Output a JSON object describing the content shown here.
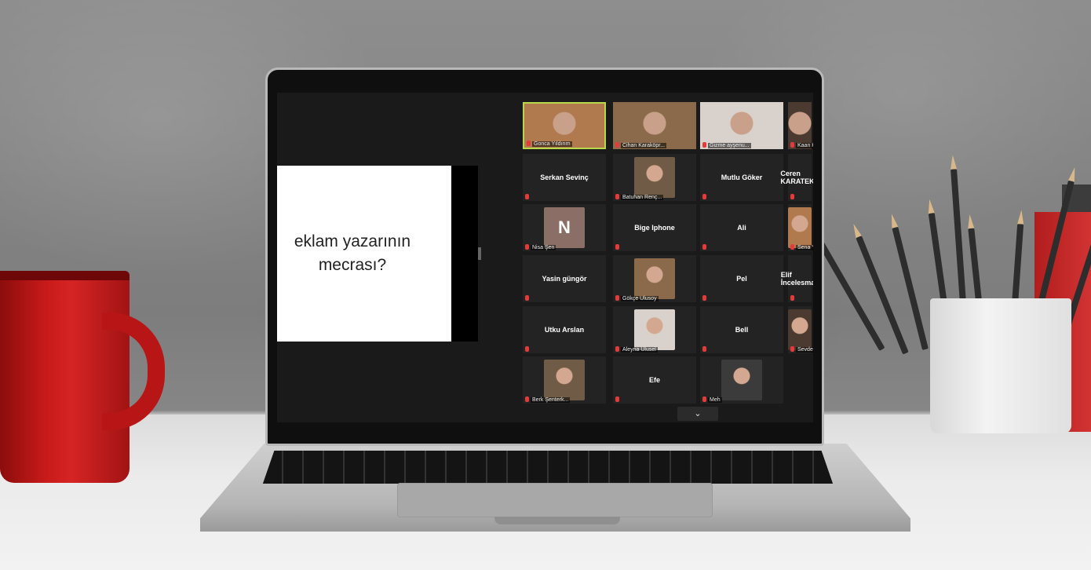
{
  "slide": {
    "line1": "eklam yazarının",
    "line2": "mecrası?"
  },
  "tiles": [
    {
      "name": "Gonca Yıldırım",
      "video": true,
      "active": true
    },
    {
      "name": "Cihan Karaköpr...",
      "video": true
    },
    {
      "name": "Gizme ayşenu...",
      "video": true
    },
    {
      "name": "Kaan K",
      "video": true
    },
    {
      "name": "Serkan Sevinç",
      "video": false
    },
    {
      "name": "Batuhan Renç...",
      "video": true
    },
    {
      "name": "Mutlu Göker",
      "video": false
    },
    {
      "name": "Ceren KARATEKE",
      "video": false
    },
    {
      "name": "Nisa Şen",
      "video": true,
      "initial": "N"
    },
    {
      "name": "Bige Iphone",
      "video": false
    },
    {
      "name": "Ali",
      "video": false
    },
    {
      "name": "Sena Yılmaz",
      "video": true
    },
    {
      "name": "Yasin güngör",
      "video": false
    },
    {
      "name": "Gökçe Ulusoy",
      "video": true
    },
    {
      "name": "Pel",
      "video": false
    },
    {
      "name": "Elif İncelesmail",
      "video": false
    },
    {
      "name": "Utku Arslan",
      "video": false
    },
    {
      "name": "Aleyna Ulusel",
      "video": true
    },
    {
      "name": "Bell",
      "video": false
    },
    {
      "name": "Sevde Zeyne...",
      "video": true
    },
    {
      "name": "Berk Şenterk...",
      "video": true
    },
    {
      "name": "Efe",
      "video": false
    },
    {
      "name": "Meh",
      "video": true
    }
  ],
  "scroll_icon": "chevron-down-icon",
  "colors": {
    "active_speaker": "#b7d84a",
    "mute": "#e23b3b",
    "mug": "#c81a1a"
  }
}
